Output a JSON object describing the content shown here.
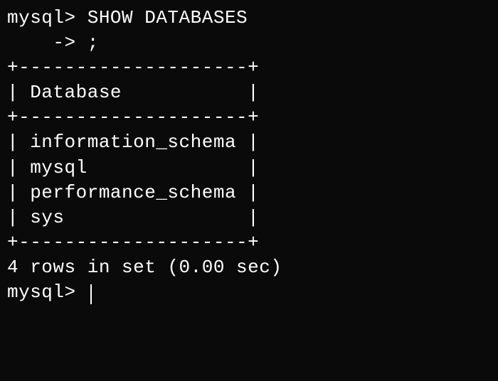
{
  "prompt1": "mysql> ",
  "command1": "SHOW DATABASES",
  "continuation_prompt": "    -> ",
  "command2": ";",
  "border_top": "+--------------------+",
  "header_row": "| Database           |",
  "border_mid": "+--------------------+",
  "row1": "| information_schema |",
  "row2": "| mysql              |",
  "row3": "| performance_schema |",
  "row4": "| sys                |",
  "border_bottom": "+--------------------+",
  "summary": "4 rows in set (0.00 sec)",
  "blank": "",
  "prompt2": "mysql> ",
  "chart_data": {
    "type": "table",
    "title": "SHOW DATABASES",
    "columns": [
      "Database"
    ],
    "rows": [
      [
        "information_schema"
      ],
      [
        "mysql"
      ],
      [
        "performance_schema"
      ],
      [
        "sys"
      ]
    ],
    "row_count": 4,
    "elapsed_sec": 0.0
  }
}
